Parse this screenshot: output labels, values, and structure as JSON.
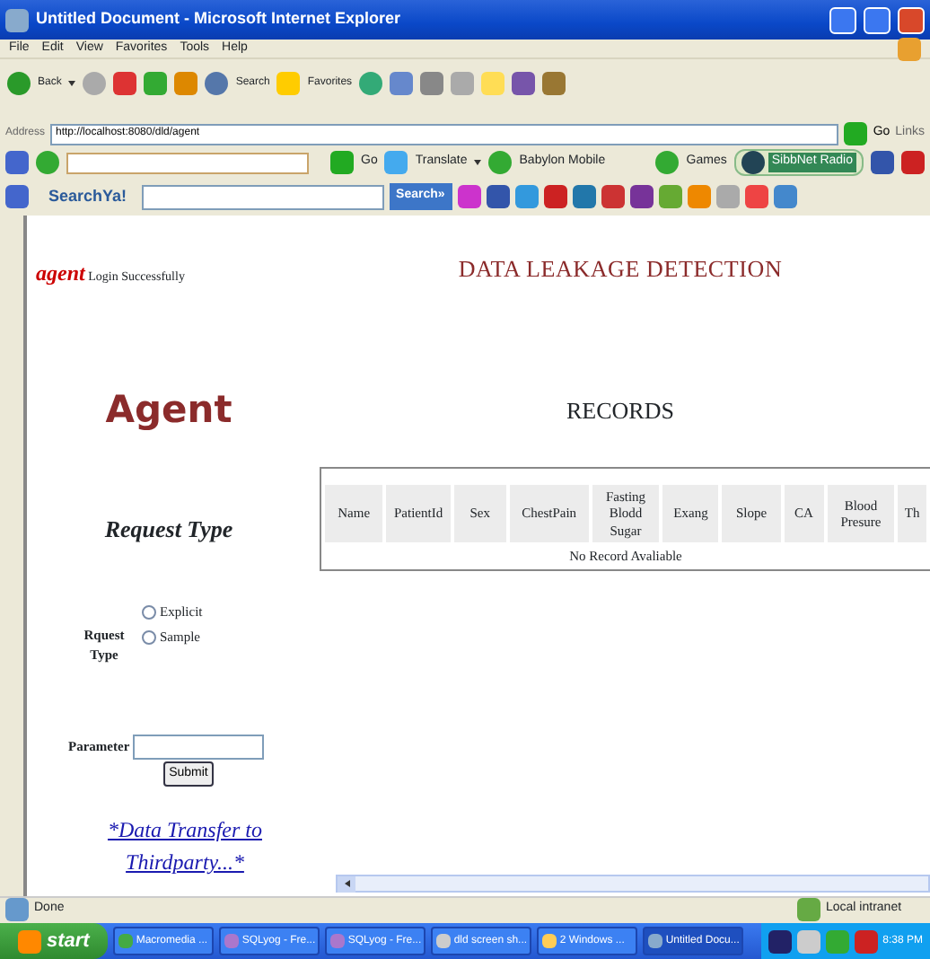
{
  "window": {
    "title": "Untitled Document - Microsoft Internet Explorer"
  },
  "menu": [
    "File",
    "Edit",
    "View",
    "Favorites",
    "Tools",
    "Help"
  ],
  "toolbar": {
    "back": "Back",
    "search": "Search",
    "favorites": "Favorites"
  },
  "address": {
    "label": "Address",
    "url": "http://localhost:8080/dld/agent",
    "go": "Go",
    "links": "Links"
  },
  "toolbar2": {
    "go": "Go",
    "translate": "Translate",
    "babylon": "Babylon Mobile",
    "games": "Games",
    "radio": "SibbNet Radio"
  },
  "searchbar": {
    "brand": "SearchYa!",
    "button": "Search»"
  },
  "page": {
    "user": "agent",
    "login": "Login Successfully",
    "heading": "DATA LEAKAGE DETECTION",
    "agent_title": "Agent",
    "records_title": "RECORDS",
    "request_title": "Request Type",
    "request_label": "Rquest Type",
    "options": [
      {
        "label": "Explicit",
        "selected": false
      },
      {
        "label": "Sample",
        "selected": false
      }
    ],
    "parameter_label": "Parameter",
    "submit": "Submit",
    "link": "*Data Transfer to Thirdparty...*"
  },
  "table": {
    "columns": [
      "Name",
      "PatientId",
      "Sex",
      "ChestPain",
      "Fasting Blodd Sugar",
      "Exang",
      "Slope",
      "CA",
      "Blood Presure",
      "Th"
    ],
    "empty": "No Record Avaliable"
  },
  "status_bar": {
    "text": "Done",
    "zone": "Local intranet"
  },
  "taskbar": {
    "start": "start",
    "items": [
      {
        "label": "Macromedia ...",
        "selected": false
      },
      {
        "label": "SQLyog - Fre...",
        "selected": false
      },
      {
        "label": "SQLyog - Fre...",
        "selected": false
      },
      {
        "label": "dld screen sh...",
        "selected": false
      },
      {
        "label": "2 Windows ...",
        "selected": false
      },
      {
        "label": "Untitled Docu...",
        "selected": true
      }
    ],
    "clock": "8:38 PM"
  }
}
